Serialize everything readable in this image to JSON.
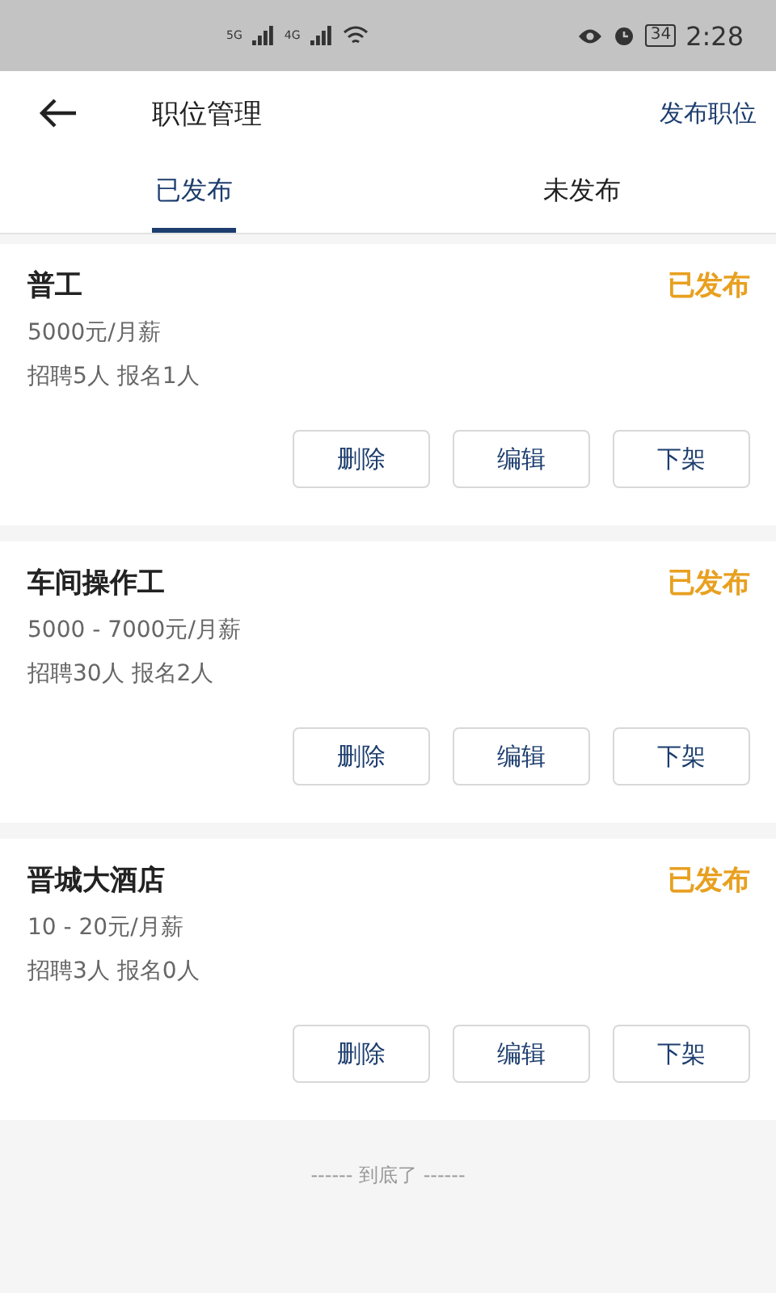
{
  "status_bar": {
    "networks": [
      "5G",
      "4G"
    ],
    "battery": "34",
    "time": "2:28"
  },
  "header": {
    "title": "职位管理",
    "action": "发布职位"
  },
  "tabs": [
    {
      "label": "已发布",
      "selected": true
    },
    {
      "label": "未发布",
      "selected": false
    }
  ],
  "jobs": [
    {
      "title": "普工",
      "status": "已发布",
      "salary": "5000元/月薪",
      "stats": "招聘5人 报名1人",
      "buttons": [
        "删除",
        "编辑",
        "下架"
      ]
    },
    {
      "title": "车间操作工",
      "status": "已发布",
      "salary": "5000 - 7000元/月薪",
      "stats": "招聘30人 报名2人",
      "buttons": [
        "删除",
        "编辑",
        "下架"
      ]
    },
    {
      "title": "晋城大酒店",
      "status": "已发布",
      "salary": "10 - 20元/月薪",
      "stats": "招聘3人 报名0人",
      "buttons": [
        "删除",
        "编辑",
        "下架"
      ]
    }
  ],
  "footer": "------ 到底了 ------"
}
